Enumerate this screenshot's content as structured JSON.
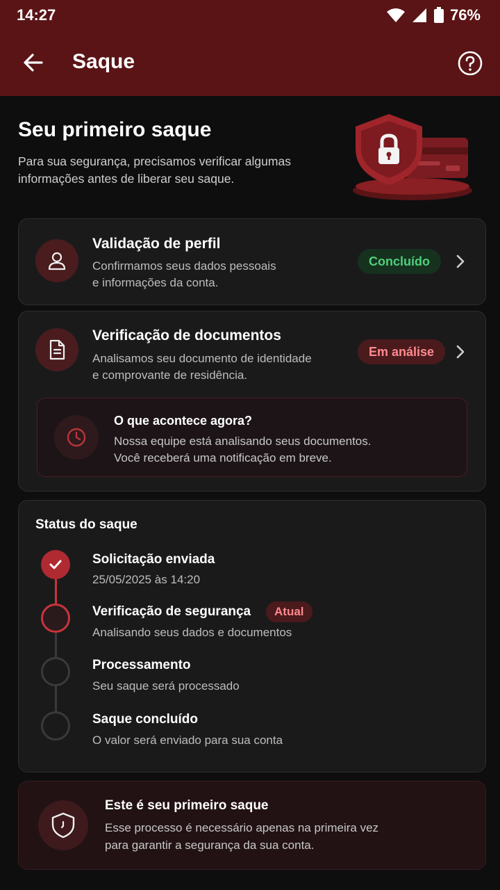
{
  "status_bar": {
    "time": "14:27",
    "battery": "76%",
    "icons": [
      "wifi-icon",
      "signal-icon",
      "battery-icon"
    ]
  },
  "app_bar": {
    "title": "Saque",
    "back_icon": "arrow-left-icon",
    "help_icon": "help-circle-icon"
  },
  "hero": {
    "title": "Seu primeiro saque",
    "subtitle": "Para sua segurança, precisamos verificar algumas informações antes de liberar seu saque."
  },
  "steps": [
    {
      "title": "Validação de perfil",
      "description_line1": "Confirmamos seus dados pessoais",
      "description_line2": "e informações da conta.",
      "badge": "Concluído",
      "icon": "user-icon"
    },
    {
      "title": "Verificação de documentos",
      "description_line1": "Analisamos seu documento de identidade",
      "description_line2": "e comprovante de residência.",
      "badge": "Em análise",
      "icon": "document-icon"
    }
  ],
  "info": {
    "title": "O que acontece agora?",
    "line1": "Nossa equipe está analisando seus documentos.",
    "line2": "Você receberá uma notificação em breve."
  },
  "timeline": {
    "heading": "Status do saque",
    "items": [
      {
        "title": "Solicitação enviada",
        "description": "25/05/2025 às 14:20",
        "state": "done"
      },
      {
        "title": "Verificação de segurança",
        "description": "Analisando seus dados e documentos",
        "state": "current",
        "badge": "Atual"
      },
      {
        "title": "Processamento",
        "description": "Seu saque será processado",
        "state": "pending"
      },
      {
        "title": "Saque concluído",
        "description": "O valor será enviado para sua conta",
        "state": "pending"
      }
    ]
  },
  "footer_card": {
    "title": "Este é seu primeiro saque",
    "line1": "Esse processo é necessário apenas na primeira vez",
    "line2": "para garantir a segurança da sua conta."
  },
  "colors": {
    "brand": "#5a1416",
    "accent": "#c8343b",
    "success": "#4fd07b",
    "warning_text": "#ff8a8e"
  }
}
